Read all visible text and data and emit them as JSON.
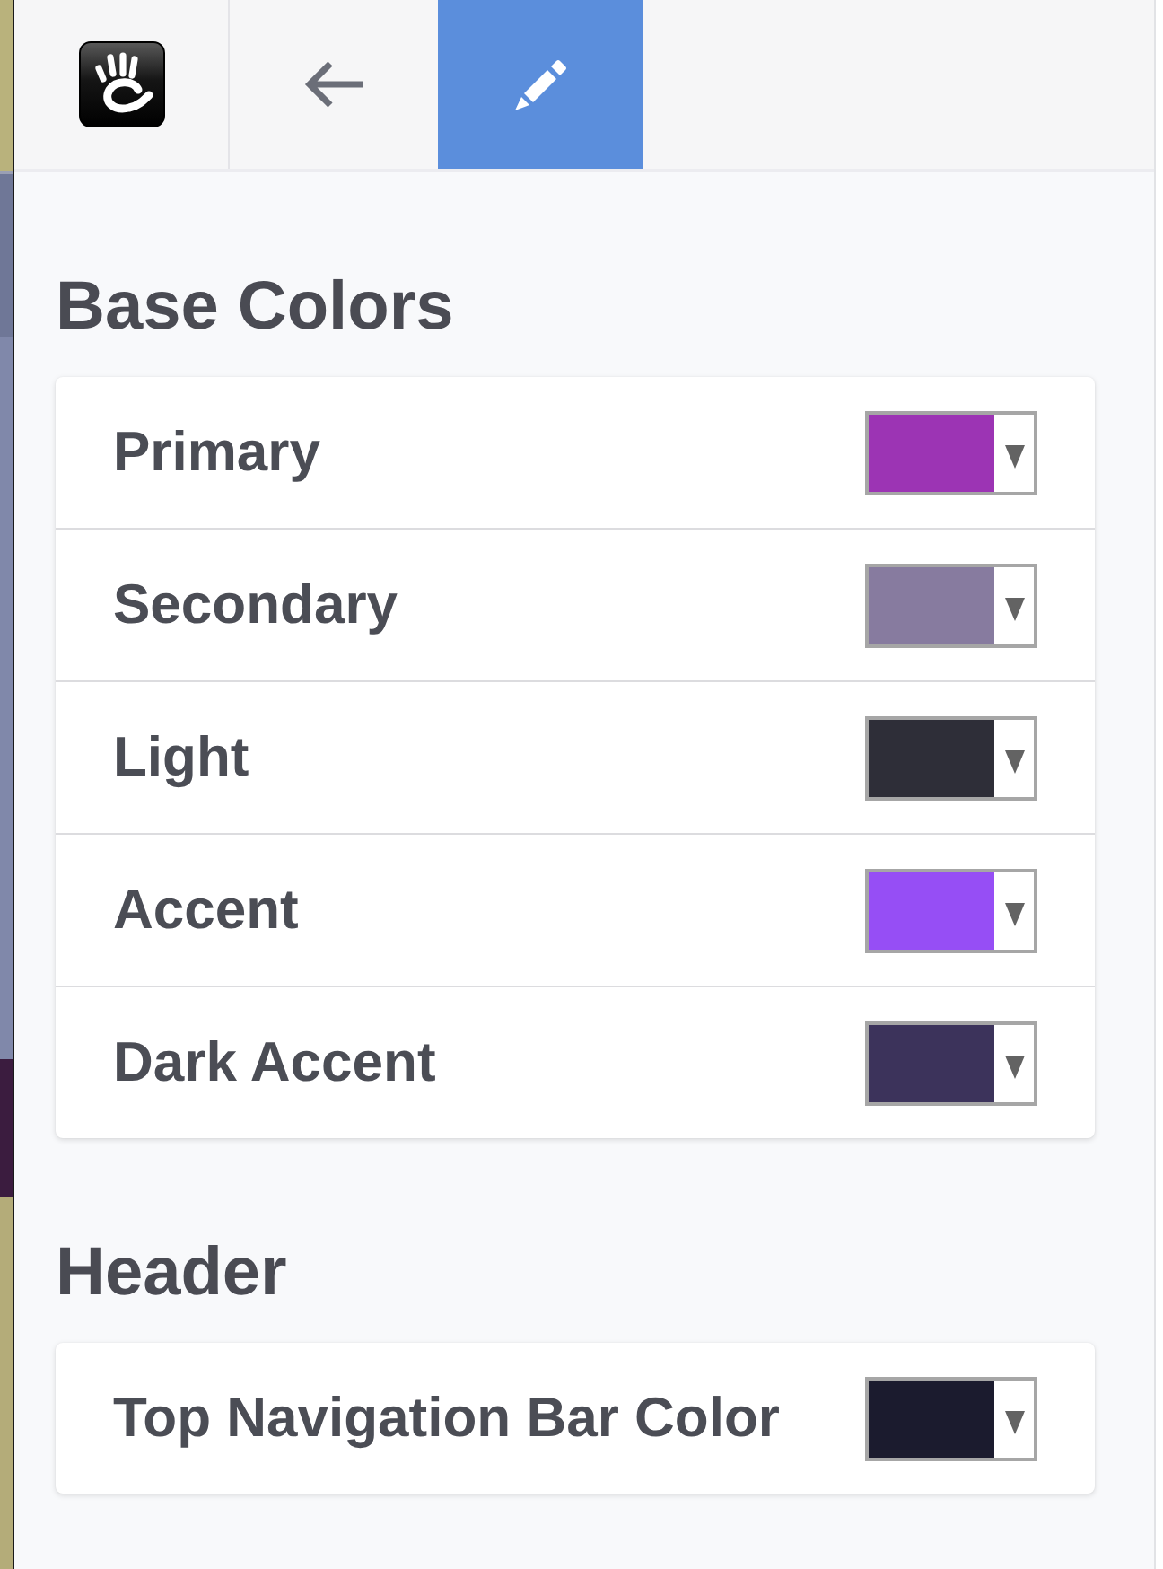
{
  "toolbar": [
    {
      "kind": "logo",
      "selected": false
    },
    {
      "kind": "back",
      "selected": false
    },
    {
      "kind": "edit",
      "selected": true
    }
  ],
  "sections": [
    {
      "title": "Base Colors",
      "items": [
        {
          "label": "Primary",
          "color": "#9c34b4"
        },
        {
          "label": "Secondary",
          "color": "#877b9f"
        },
        {
          "label": "Light",
          "color": "#2e2e38"
        },
        {
          "label": "Accent",
          "color": "#964ef5"
        },
        {
          "label": "Dark Accent",
          "color": "#3c335b"
        }
      ]
    },
    {
      "title": "Header",
      "items": [
        {
          "label": "Top Navigation Bar Color",
          "color": "#1b1b2e"
        }
      ]
    }
  ]
}
